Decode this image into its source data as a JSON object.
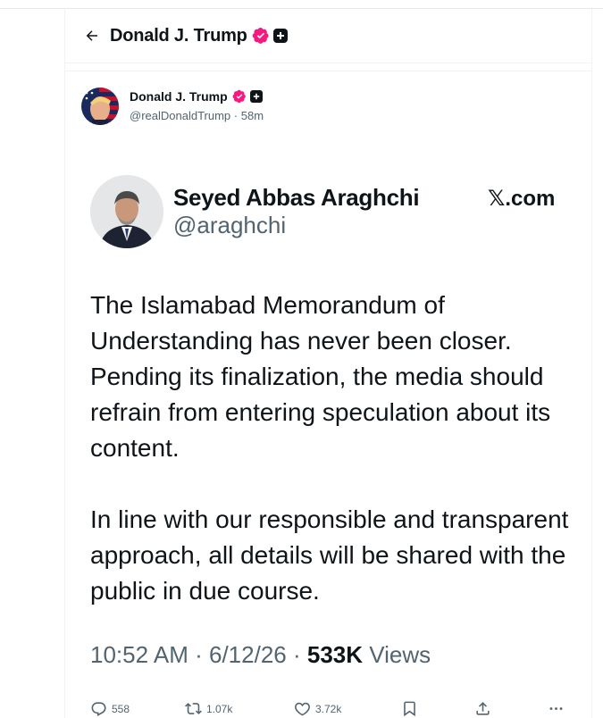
{
  "header": {
    "title": "Donald J. Trump"
  },
  "post": {
    "author_name": "Donald J. Trump",
    "author_handle": "@realDonaldTrump",
    "separator": "·",
    "time_ago": "58m"
  },
  "quoted": {
    "name": "Seyed Abbas Araghchi",
    "handle": "@araghchi",
    "site": "𝕏.com",
    "paragraph1": "The Islamabad Memorandum of Understanding has never been closer. Pending its finalization, the media should refrain from entering speculation about its content.",
    "paragraph2": "In line with our responsible and transparent approach, all details will be shared with the public in due course.",
    "time": "10:52 AM",
    "date": "6/12/26",
    "views_count": "533K",
    "views_label": "Views",
    "sep": "·"
  },
  "actions": {
    "replies": "558",
    "reposts": "1.07k",
    "likes": "3.72k"
  },
  "colors": {
    "verified_badge": "#f91880",
    "text_primary": "#0f1419",
    "text_secondary": "#536471"
  }
}
